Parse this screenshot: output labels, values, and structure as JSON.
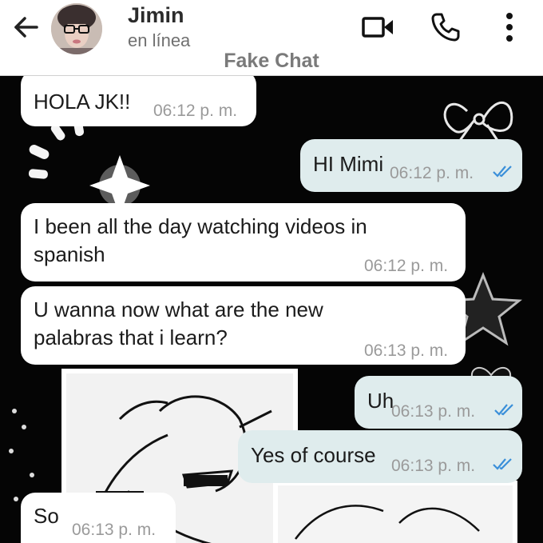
{
  "header": {
    "contact_name": "Jimin",
    "contact_status": "en línea",
    "watermark": "Fake Chat",
    "icons": [
      "arrow-left-icon",
      "video-camera-icon",
      "phone-icon",
      "more-vertical-icon"
    ]
  },
  "colors": {
    "header_bg": "#ffffff",
    "chat_bg": "#050505",
    "incoming_bubble": "#ffffff",
    "outgoing_bubble": "#dfeced",
    "read_ticks": "#3a8fd9",
    "time_text": "#9a9a9a"
  },
  "messages": [
    {
      "direction": "in",
      "text": "HOLA JK!!",
      "time": "06:12 p. m."
    },
    {
      "direction": "out",
      "text": "HI Mimi",
      "time": "06:12 p. m.",
      "read": true
    },
    {
      "direction": "in",
      "text": "I been all the day watching videos in spanish",
      "line1": "I been all the day watching videos in",
      "line2": "spanish",
      "time": "06:12 p. m."
    },
    {
      "direction": "in",
      "text": "U wanna now what are the new palabras that i learn?",
      "line1": "U wanna now what are the new",
      "line2": "palabras that i learn?",
      "time": "06:13 p. m."
    },
    {
      "direction": "out",
      "text": "Uh",
      "time": "06:13 p. m.",
      "read": true
    },
    {
      "direction": "out",
      "text": "Yes of course",
      "time": "06:13 p. m.",
      "read": true
    },
    {
      "direction": "in",
      "text": "So",
      "time": "06:13 p. m."
    }
  ]
}
